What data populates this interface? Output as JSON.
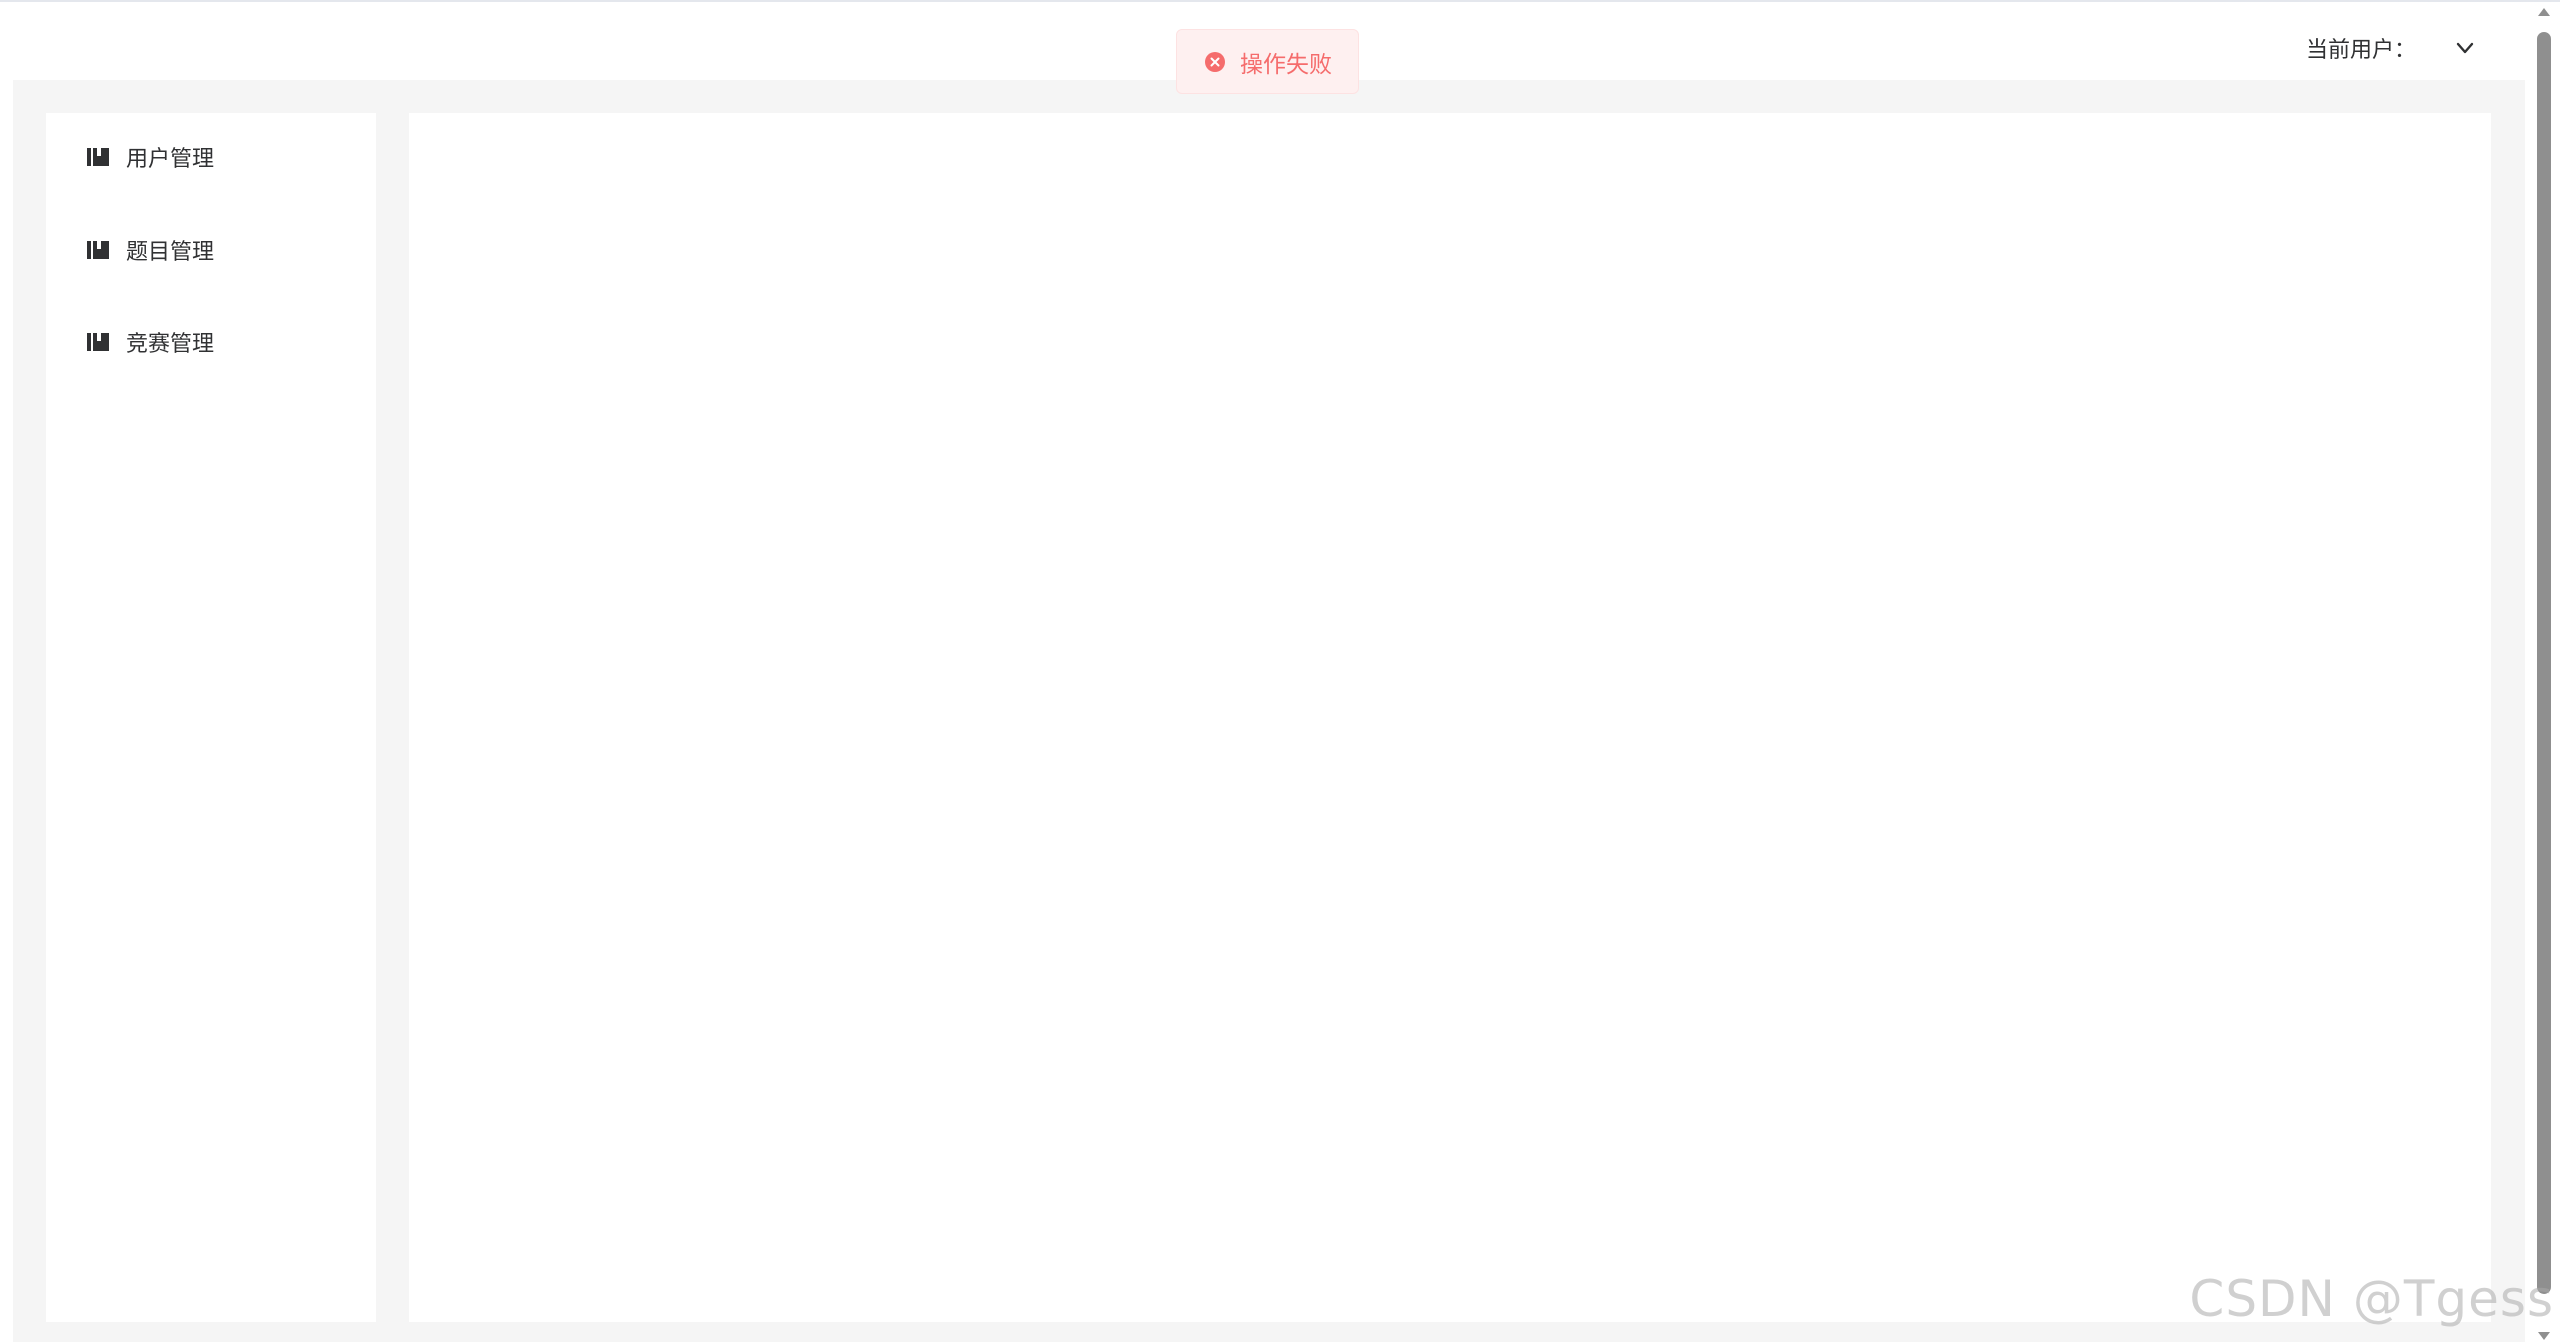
{
  "header": {
    "current_user_label": "当前用户：",
    "dropdown_icon": "chevron-down-icon"
  },
  "toast": {
    "type": "error",
    "icon": "error-circle-icon",
    "message": "操作失败",
    "color": "#f56c6c"
  },
  "sidebar": {
    "items": [
      {
        "label": "用户管理",
        "icon": "book-icon"
      },
      {
        "label": "题目管理",
        "icon": "book-icon"
      },
      {
        "label": "竞赛管理",
        "icon": "book-icon"
      }
    ]
  },
  "watermark": {
    "text": "CSDN @Tgess"
  },
  "colors": {
    "frame_bg": "#f5f5f5",
    "panel_bg": "#ffffff",
    "error": "#f56c6c",
    "error_bg": "#fef0f0"
  }
}
